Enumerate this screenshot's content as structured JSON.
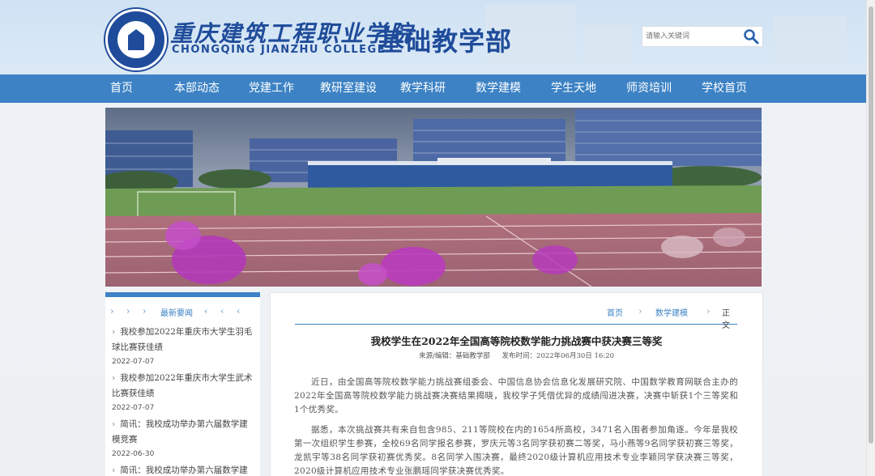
{
  "header": {
    "school_name_cn": "重庆建筑工程职业学院",
    "school_name_en": "CHONGQING JIANZHU COLLEGE",
    "department": "基础教学部",
    "search": {
      "placeholder": "请输入关键词",
      "icon": "magnifier-icon"
    },
    "logo_icon": "college-seal-icon"
  },
  "nav": {
    "items": [
      {
        "label": "首页"
      },
      {
        "label": "本部动态"
      },
      {
        "label": "党建工作"
      },
      {
        "label": "教研室建设"
      },
      {
        "label": "教学科研"
      },
      {
        "label": "数学建模"
      },
      {
        "label": "学生天地"
      },
      {
        "label": "师资培训"
      },
      {
        "label": "学校首页"
      }
    ]
  },
  "sidebar": {
    "title": "最新要闻",
    "news": [
      {
        "title": "我校参加2022年重庆市大学生羽毛球比赛获佳绩",
        "date": "2022-07-07"
      },
      {
        "title": "我校参加2022年重庆市大学生武术比赛获佳绩",
        "date": "2022-07-07"
      },
      {
        "title": "简讯：我校成功举办第六届数学建模竞赛",
        "date": "2022-06-30"
      },
      {
        "title": "简讯：我校成功举办第六届数学建",
        "date": ""
      }
    ]
  },
  "breadcrumb": {
    "home": "首页",
    "section": "数学建模",
    "current": "正文"
  },
  "article": {
    "title": "我校学生在2022年全国高等院校数学能力挑战赛中获决赛三等奖",
    "source": "来源/编辑：基础教学部",
    "published": "发布时间：2022年06月30日 16:20",
    "paragraphs": [
      "近日，由全国高等院校数学能力挑战赛组委会、中国信息协会信息化发展研究院、中国数学教育网联合主办的2022年全国高等院校数学能力挑战赛决赛结果揭晓，我校学子凭借优异的成绩闯进决赛，决赛中斩获1个三等奖和1个优秀奖。",
      "据悉，本次挑战赛共有来自包含985、211等院校在内的1654所高校，3471名入围者参加角逐。今年是我校第一次组织学生参赛，全校69名同学报名参赛，罗庆元等3名同学获初赛二等奖，马小燕等9名同学获初赛三等奖，龙凯宇等38名同学获初赛优秀奖。8名同学入围决赛，最终2020级计算机应用技术专业李颖同学获决赛三等奖，2020级计算机应用技术专业张鹏瑶同学获决赛优秀奖。"
    ]
  },
  "colors": {
    "brand_blue": "#1f4c9a",
    "nav_blue": "#3c82c4"
  }
}
